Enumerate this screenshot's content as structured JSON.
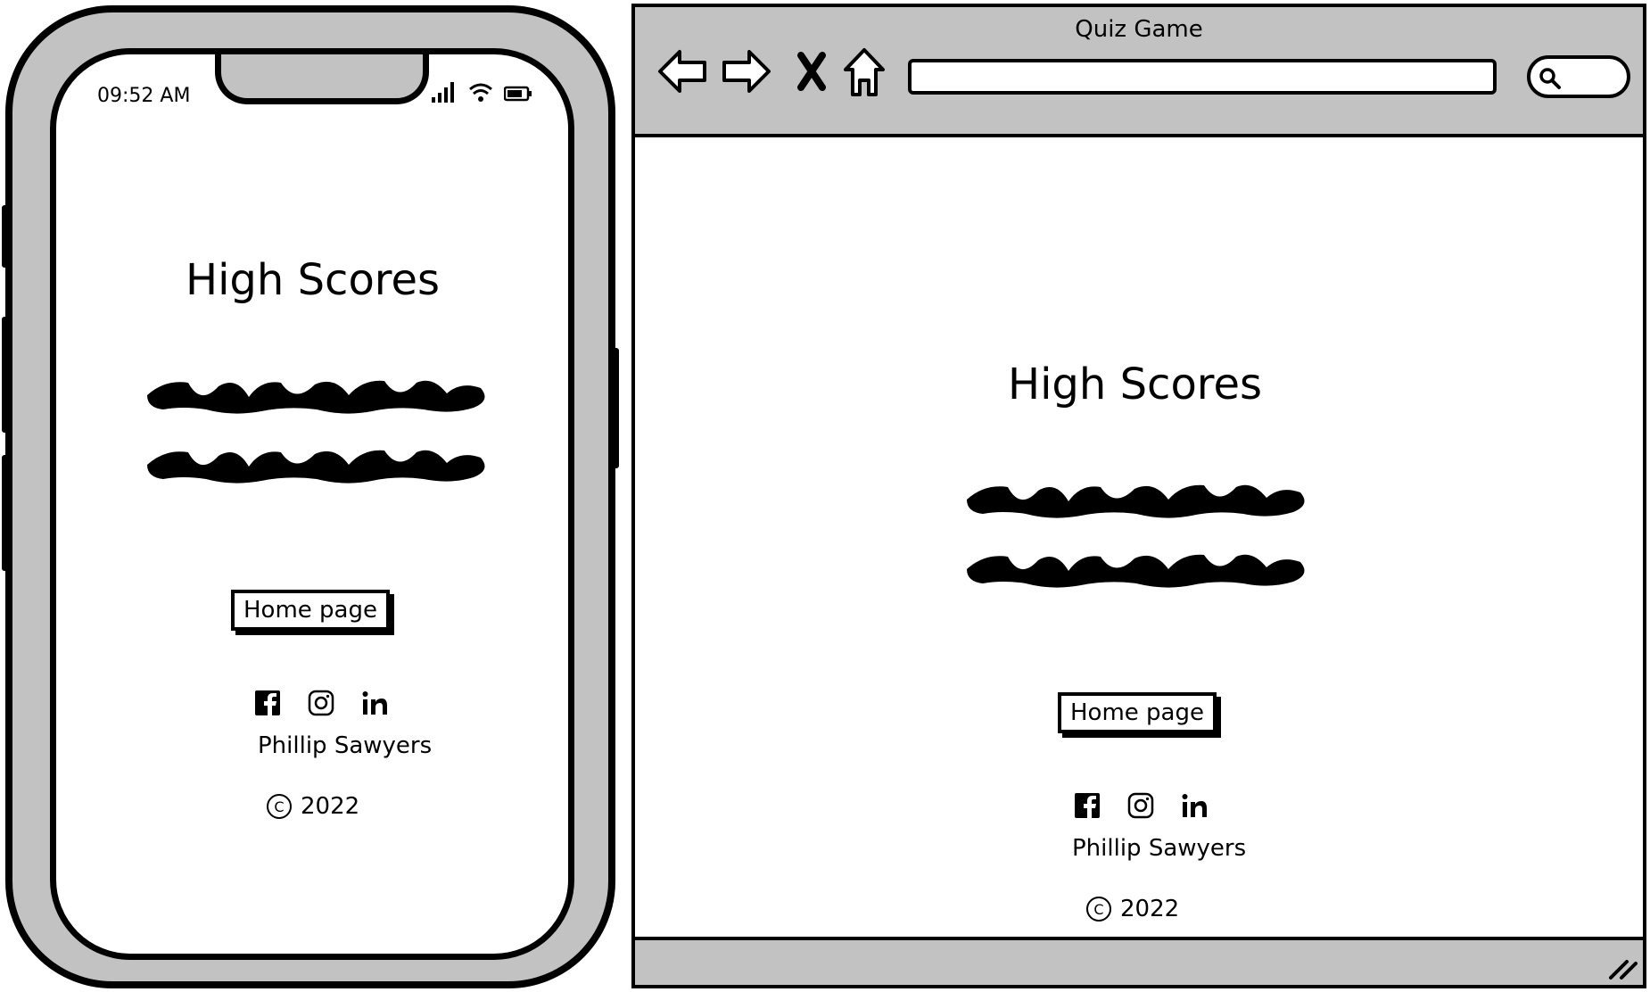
{
  "mobile": {
    "status_time": "09:52 AM",
    "page_title": "High Scores",
    "home_button": "Home page",
    "author": "Phillip Sawyers",
    "copyright_year": "2022"
  },
  "desktop": {
    "window_title": "Quiz Game",
    "page_title": "High Scores",
    "home_button": "Home page",
    "author": "Phillip Sawyers",
    "copyright_year": "2022"
  },
  "icons": {
    "social": [
      "facebook-icon",
      "instagram-icon",
      "linkedin-icon"
    ],
    "nav": [
      "back-arrow-icon",
      "forward-arrow-icon",
      "close-icon",
      "home-icon"
    ]
  },
  "colors": {
    "chrome_gray": "#c2c2c2",
    "ink": "#000000"
  }
}
